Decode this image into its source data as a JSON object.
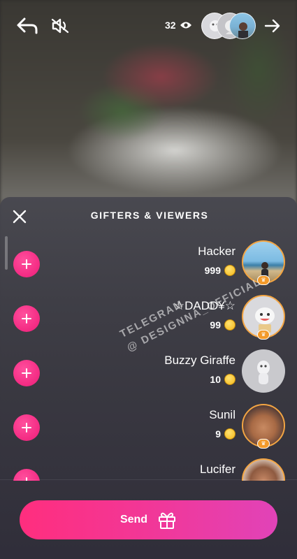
{
  "top_bar": {
    "viewer_count": "32",
    "icons": [
      "back-arrow-icon",
      "mute-speaker-icon",
      "eye-icon",
      "forward-arrow-icon"
    ]
  },
  "panel": {
    "title": "GIFTERS & VIEWERS",
    "items": [
      {
        "name": "Hacker",
        "coins": "999",
        "avatar": "photo-beach"
      },
      {
        "name": "☆DADD¥☆",
        "coins": "99",
        "avatar": "cartoon-ghost"
      },
      {
        "name": "Buzzy Giraffe",
        "coins": "10",
        "avatar": "default-cartoon"
      },
      {
        "name": "Sunil",
        "coins": "9",
        "avatar": "photo-face"
      },
      {
        "name": "Lucifer",
        "coins": "",
        "avatar": "photo-face"
      }
    ]
  },
  "watermark": {
    "line1": "TELEGRAM",
    "line2": "@ DESIGNNA_OFFICIAL"
  },
  "send_button": {
    "label": "Send"
  },
  "colors": {
    "accent": "#f52f86",
    "coin": "#f4b81c",
    "badge": "#f39a2a"
  }
}
